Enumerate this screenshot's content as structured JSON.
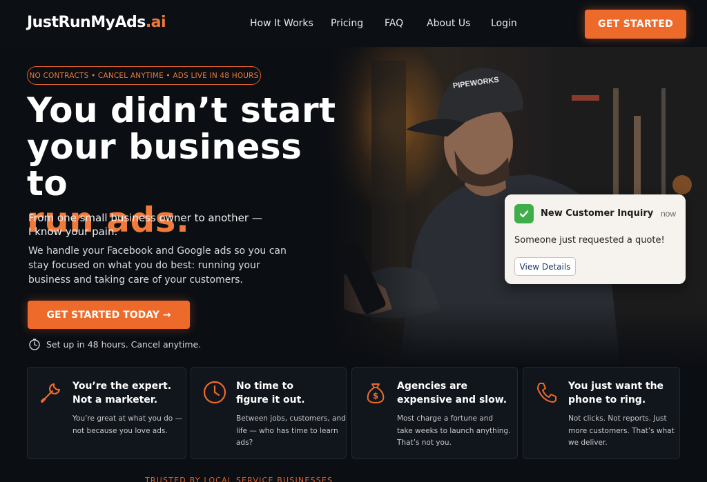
{
  "nav": {
    "logo_main": "JustRunMyAds",
    "logo_suffix": ".ai",
    "links": [
      "How It Works",
      "Pricing",
      "FAQ",
      "About Us",
      "Login"
    ],
    "cta": "GET STARTED"
  },
  "hero": {
    "pill": "NO CONTRACTS • CANCEL ANYTIME • ADS LIVE IN 48 HOURS",
    "headline_line1": "You didn’t start",
    "headline_line2": "your business to",
    "headline_accent": "run ads.",
    "subheadline_line1": "From one small business owner to another —",
    "subheadline_line2": "I know your pain.",
    "description": "We handle your Facebook and Google ads so you can stay focused on what you do best: running your business and taking care of your customers.",
    "cta": "GET STARTED TODAY →",
    "setup_note": "Set up in 48 hours. Cancel anytime.",
    "cap_text": "PIPEWORKS"
  },
  "notification": {
    "title": "New Customer Inquiry",
    "time": "now",
    "message": "Someone just requested a quote!",
    "button": "View Details"
  },
  "cards": [
    {
      "icon": "wrench-icon",
      "title_line1": "You’re the expert.",
      "title_line2": "Not a marketer.",
      "text": "You’re great at what you do — not because you love ads."
    },
    {
      "icon": "clock-icon",
      "title_line1": "No time to",
      "title_line2": "figure it out.",
      "text": "Between jobs, customers, and life — who has time to learn ads?"
    },
    {
      "icon": "money-bag-icon",
      "title_line1": "Agencies are",
      "title_line2": "expensive and slow.",
      "text": "Most charge a fortune and take weeks to launch anything. That’s not you."
    },
    {
      "icon": "phone-icon",
      "title_line1": "You just want the",
      "title_line2": "phone to ring.",
      "text": "Not clicks. Not reports. Just more customers. That’s what we deliver."
    }
  ],
  "trusted_label": "TRUSTED BY LOCAL SERVICE BUSINESSES",
  "colors": {
    "accent": "#ee6a2b",
    "background": "#0b0e13",
    "card": "#11151c",
    "notification": "#f6f3ee",
    "check": "#3fae4a"
  }
}
